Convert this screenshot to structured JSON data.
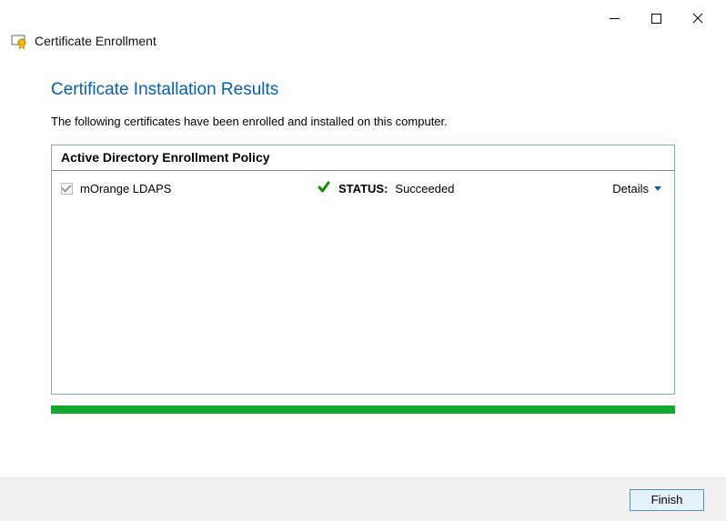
{
  "window": {
    "title": "Certificate Enrollment"
  },
  "page": {
    "heading": "Certificate Installation Results",
    "description": "The following certificates have been enrolled and installed on this computer."
  },
  "policy": {
    "header": "Active Directory Enrollment Policy",
    "certificates": [
      {
        "name": "mOrange LDAPS",
        "status_label": "STATUS:",
        "status_value": "Succeeded",
        "details_label": "Details"
      }
    ]
  },
  "footer": {
    "finish_label": "Finish"
  }
}
